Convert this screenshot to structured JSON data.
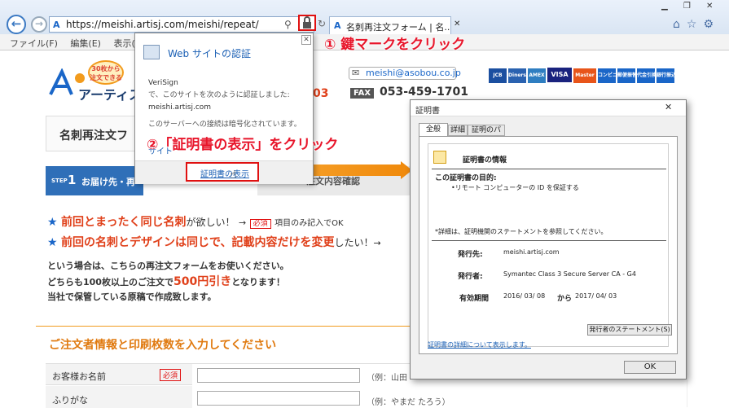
{
  "browser": {
    "url": "https://meishi.artisj.com/meishi/repeat/",
    "tab_title": "名刺再注文フォーム | 名...",
    "menu": [
      "ファイル(F)",
      "編集(E)",
      "表示(V)"
    ]
  },
  "site": {
    "logo_text": "アーティス",
    "badge_text": "30枚から注文できる",
    "email": "meishi@asobou.co.jp",
    "fax_label": "FAX",
    "fax": "053-459-1701",
    "phone_partial": "03",
    "page_title": "名刺再注文フ",
    "step_label": "STEP",
    "step_num": "1",
    "step1_text": "お届け先・再",
    "step3_text": "注文内容確認",
    "cards": [
      "JCB",
      "Diners",
      "AMEX",
      "VISA",
      "Master",
      "コンビニ",
      "郵便振替",
      "代金引換",
      "銀行振込"
    ],
    "line1_a": "前回とまったく同じ名刺",
    "line1_b": "が欲しい！",
    "line1_req": "必須",
    "line1_c": "項目のみ記入でOK",
    "line2_a": "前回の名刺とデザインは同じで、記載内容だけを変更",
    "line2_b": "したい！",
    "body1": "という場合は、こちらの再注文フォームをお使いください。",
    "body2_a": "どちらも100枚以上のご注文で",
    "body2_b": "500円引き",
    "body2_c": "となります！",
    "body3": "当社で保管している原稿で作成致します。",
    "section_title": "ご注文者情報と印刷枚数を入力してください",
    "rows": [
      {
        "label": "お客様お名前",
        "required": "必須",
        "example": "（例：山田"
      },
      {
        "label": "ふりがな",
        "required": "",
        "example": "（例：やまだ たろう）"
      }
    ]
  },
  "security_popup": {
    "title": "Web サイトの認証",
    "issuer": "VeriSign",
    "identified": "で、このサイトを次のように認証しました:",
    "domain": "meishi.artisj.com",
    "encrypted": "このサーバーへの接続は暗号化されています。",
    "site_link": "サイト",
    "view_cert": "証明書の表示"
  },
  "annotations": {
    "step1": "① 鍵マークをクリック",
    "step2": "②「証明書の表示」をクリック"
  },
  "cert_dialog": {
    "title": "証明書",
    "tabs": [
      "全般",
      "詳細",
      "証明のパス"
    ],
    "info_title": "証明書の情報",
    "purpose_label": "この証明書の目的:",
    "purpose_item": "•リモート コンピューターの ID を保証する",
    "note": "*詳細は、証明機関のステートメントを参照してください。",
    "issued_to_label": "発行先:",
    "issued_to": "meishi.artisj.com",
    "issued_by_label": "発行者:",
    "issued_by": "Symantec Class 3 Secure Server CA - G4",
    "valid_label": "有効期間",
    "valid_from": "2016/ 03/ 08",
    "valid_kara": "から",
    "valid_to": "2017/ 04/ 03",
    "statement_button": "発行者のステートメント(S)",
    "details_link": "証明書の詳細について表示します。",
    "ok": "OK"
  }
}
